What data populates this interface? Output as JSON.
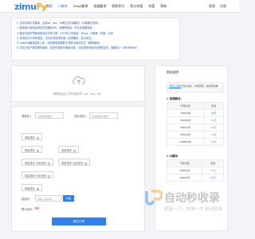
{
  "header": {
    "logo_main": "zimu",
    "logo_accent": "Fy",
    "nav": [
      "首页",
      "AI翻译",
      "Deepl翻译",
      "批量翻译",
      "获取积分",
      "积分充值",
      "充值",
      "帮助"
    ],
    "nav_right": [
      "登录",
      "注册"
    ]
  },
  "notice": {
    "lines": [
      "1. 支持字幕文件翻译，支持srt、ass、vtt等主流字幕格式（字幕格式说明）",
      "2. 翻译接口使用全球领先的翻译API，准确率更高，专业术语更精准",
      "3. 翻译字幕字符数量按实际字符计算，1000字以内免费，Deepl、AI翻译（字幕）计费",
      "4. 支持多达30多种语言，支持中英双语字幕（双语翻译，显示原文）",
      "5. Deepl/AI翻译全新上线，功能更强效果更佳 更多功能请关注（推荐使用）",
      "6. 本站为用户提供便利服务，若您在使用中遇到问题，请及时联系我们处理或反馈，客服QQ：2851988829"
    ],
    "highlight": "字幕格式说明"
  },
  "upload": {
    "hint": "拖拽或点击上传字幕文件（srt、ass、vtt）"
  },
  "form": {
    "source_label": "源语言1：",
    "source_placeholder": "请选择源语言",
    "target_label": "目标语言2：",
    "target_placeholder": "请选择目标语言",
    "options": [
      "原始语言",
      "原始语言",
      "原始语言",
      "原始语言+目标语言",
      "原始语言+目标语言",
      "原始语言+目标语言",
      "原始语言"
    ],
    "code_label": "验证码：",
    "code_placeholder": "请输入验证码",
    "verify_button": "获取",
    "price_label": "预计费用：",
    "price_value": "¥0",
    "submit_label": "提交订单"
  },
  "sidebar": {
    "title": "帮助说明",
    "note_link": "字幕工具箱",
    "note_text": "同步/合并、时间调整、格式转换等",
    "section1_title": "1. 普通翻译：",
    "table1_headers": [
      "字幕长度",
      "费用"
    ],
    "table1_rows": [
      [
        "1000以内",
        "免费"
      ],
      [
        "2000以内",
        "0.1元"
      ],
      [
        "3000以内",
        "0.2元"
      ],
      [
        "5000以内",
        "0.3元"
      ],
      [
        "10000以内",
        "0.5元"
      ]
    ],
    "section2_title": "2. AI翻译：",
    "table2_headers": [
      "字幕长度",
      "费用"
    ],
    "table2_rows": [
      [
        "1000以内",
        "0.1元"
      ],
      [
        "3000以内",
        "0.5元"
      ]
    ]
  },
  "watermark": {
    "title": "自动秒收录",
    "subtitle": "链接一下，收录一次 自动收录"
  }
}
